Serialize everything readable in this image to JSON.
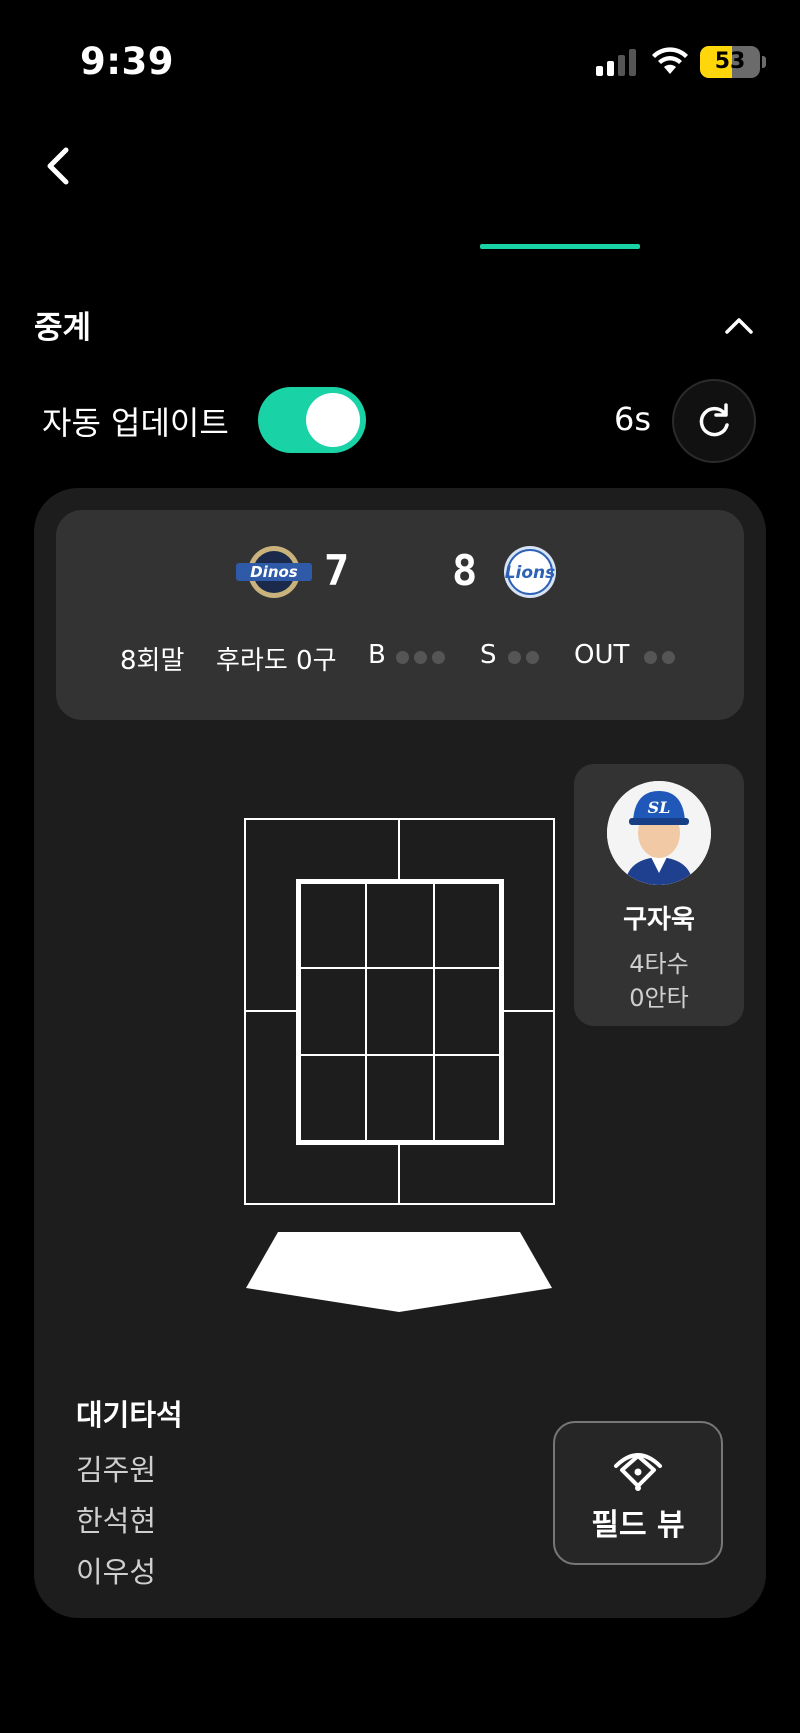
{
  "status_bar": {
    "time": "9:39",
    "battery": "53",
    "battery_level": 0.53
  },
  "section": {
    "title": "중계"
  },
  "auto_update": {
    "label": "자동 업데이트",
    "enabled": true,
    "countdown": "6s"
  },
  "scoreboard": {
    "away": {
      "logo_text": "Dinos",
      "score": "7"
    },
    "home": {
      "logo_text": "Lions",
      "score": "8"
    },
    "inning": "8회말",
    "pitcher": "후라도 0구",
    "ball_label": "B",
    "strike_label": "S",
    "out_label": "OUT",
    "balls": 0,
    "strikes": 0,
    "outs": 0
  },
  "batter": {
    "name": "구자욱",
    "at_bats": "4타수",
    "hits": "0안타"
  },
  "on_deck": {
    "title": "대기타석",
    "players": [
      "김주원",
      "한석현",
      "이우성"
    ]
  },
  "field_view": {
    "label": "필드 뷰"
  },
  "colors": {
    "accent": "#19d3a7",
    "card": "#1d1d1d",
    "scoreboard": "#333333",
    "battery": "#ffd60a"
  }
}
